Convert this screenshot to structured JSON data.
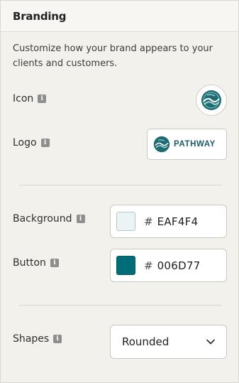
{
  "header": {
    "title": "Branding"
  },
  "description": "Customize how your brand appears to your clients and customers.",
  "icon_row": {
    "label": "Icon",
    "info_icon": "info-icon"
  },
  "logo_row": {
    "label": "Logo",
    "info_icon": "info-icon",
    "logo_text": "PATHWAY"
  },
  "background_row": {
    "label": "Background",
    "hash": "#",
    "value": "EAF4F4",
    "swatch_color": "#EAF4F4"
  },
  "button_row": {
    "label": "Button",
    "hash": "#",
    "value": "006D77",
    "swatch_color": "#006D77"
  },
  "shapes_row": {
    "label": "Shapes",
    "selected": "Rounded",
    "dropdown_icon": "chevron-down-icon"
  },
  "colors": {
    "brand_teal": "#1e6b72",
    "panel_bg": "#f2f1ec"
  }
}
